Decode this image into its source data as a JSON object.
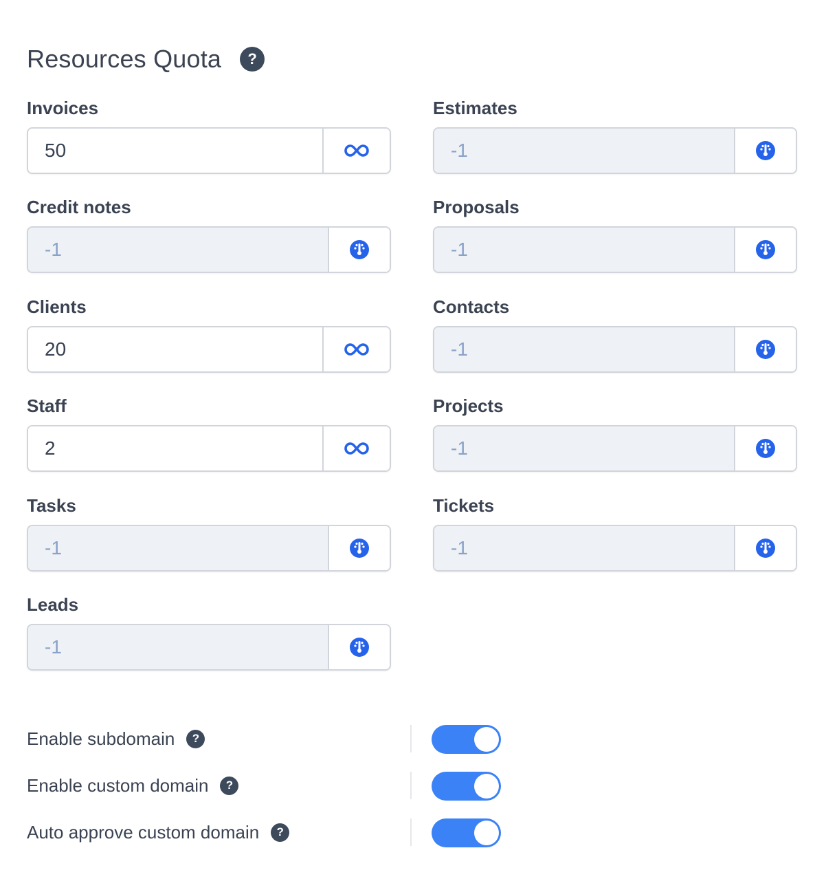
{
  "section": {
    "title": "Resources Quota",
    "help_glyph": "?"
  },
  "fields": {
    "invoices": {
      "label": "Invoices",
      "value": "50",
      "addon_icon": "infinity-icon"
    },
    "estimates": {
      "label": "Estimates",
      "value": "-1",
      "addon_icon": "gauge-icon"
    },
    "credit_notes": {
      "label": "Credit notes",
      "value": "-1",
      "addon_icon": "gauge-icon"
    },
    "proposals": {
      "label": "Proposals",
      "value": "-1",
      "addon_icon": "gauge-icon"
    },
    "clients": {
      "label": "Clients",
      "value": "20",
      "addon_icon": "infinity-icon"
    },
    "contacts": {
      "label": "Contacts",
      "value": "-1",
      "addon_icon": "gauge-icon"
    },
    "staff": {
      "label": "Staff",
      "value": "2",
      "addon_icon": "infinity-icon"
    },
    "projects": {
      "label": "Projects",
      "value": "-1",
      "addon_icon": "gauge-icon"
    },
    "tasks": {
      "label": "Tasks",
      "value": "-1",
      "addon_icon": "gauge-icon"
    },
    "tickets": {
      "label": "Tickets",
      "value": "-1",
      "addon_icon": "gauge-icon"
    },
    "leads": {
      "label": "Leads",
      "value": "-1",
      "addon_icon": "gauge-icon"
    }
  },
  "toggles": {
    "subdomain": {
      "label": "Enable subdomain",
      "enabled": true
    },
    "custom_domain": {
      "label": "Enable custom domain",
      "enabled": true
    },
    "auto_approve": {
      "label": "Auto approve custom domain",
      "enabled": true
    }
  },
  "colors": {
    "accent": "#3b82f6",
    "icon_blue": "#2563eb",
    "help_bg": "#3d4a5c",
    "disabled_bg": "#eef1f5",
    "disabled_text": "#8aa2c8"
  }
}
